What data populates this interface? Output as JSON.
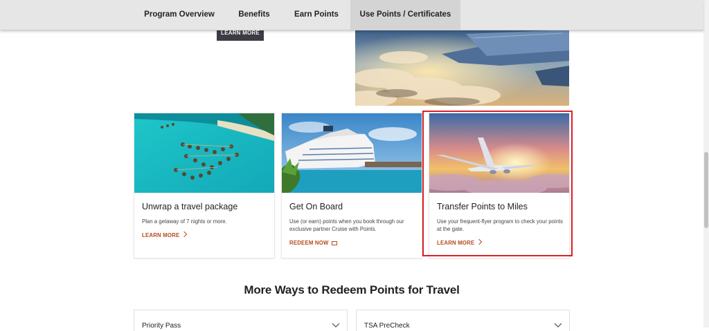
{
  "nav": {
    "tabs": [
      {
        "label": "Program Overview"
      },
      {
        "label": "Benefits"
      },
      {
        "label": "Earn Points"
      },
      {
        "label": "Use Points / Certificates",
        "active": true
      }
    ]
  },
  "top_section": {
    "button_label": "LEARN MORE"
  },
  "cards": [
    {
      "title": "Unwrap a travel package",
      "description": "Plan a getaway of 7 nights or more.",
      "link": "LEARN MORE",
      "link_icon": "chevron-right-icon"
    },
    {
      "title": "Get On Board",
      "description": "Use (or earn) points when you book through our exclusive partner Cruise with Points.",
      "link": "REDEEM NOW",
      "link_icon": "external-window-icon"
    },
    {
      "title": "Transfer Points to Miles",
      "description": "Use your frequent-flyer program to check your points at the gate.",
      "link": "LEARN MORE",
      "link_icon": "chevron-right-icon"
    }
  ],
  "more_ways": {
    "title": "More Ways to Redeem Points for Travel",
    "accordions": [
      {
        "label": "Priority Pass"
      },
      {
        "label": "TSA PreCheck"
      }
    ]
  },
  "colors": {
    "nav_bg": "#e6e6e6",
    "link": "#b5481d",
    "highlight": "#d91f26",
    "dark_button": "#3d3c44"
  }
}
